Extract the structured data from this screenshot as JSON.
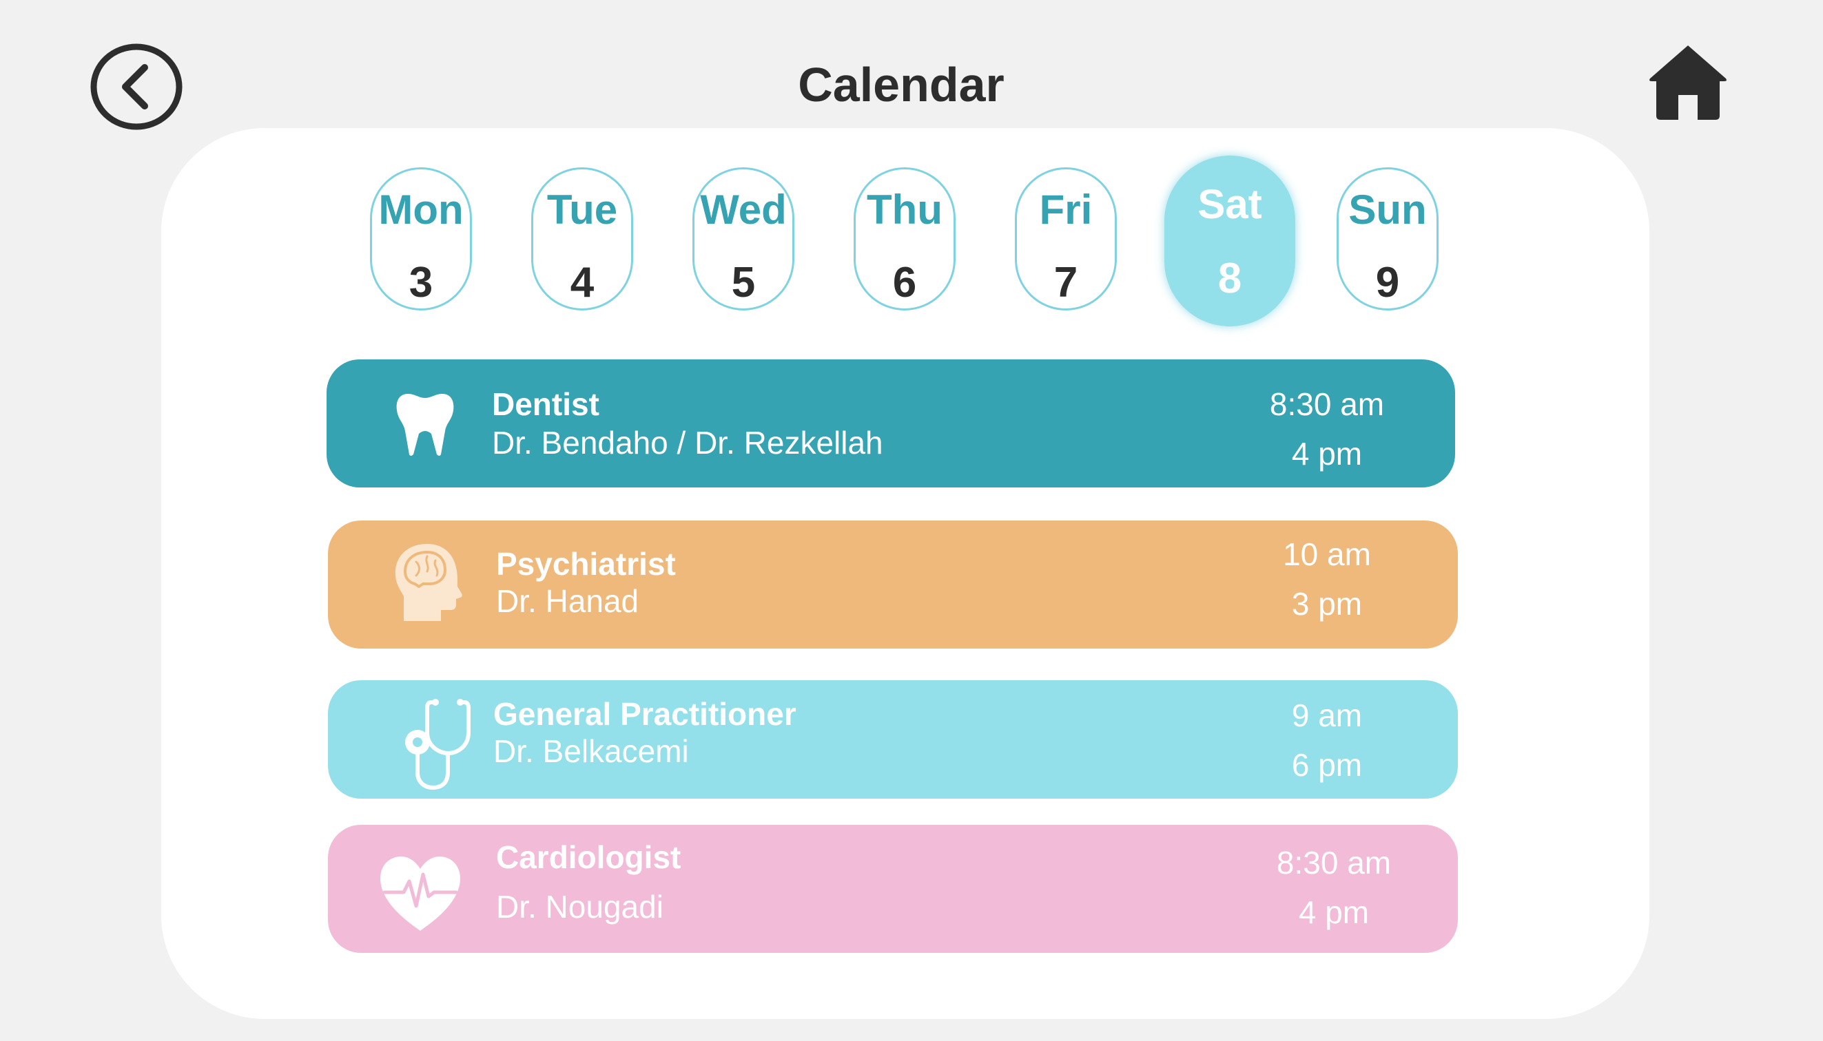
{
  "header": {
    "title": "Calendar"
  },
  "icons": {
    "back": "chevron-left-circle-icon",
    "home": "home-icon"
  },
  "colors": {
    "background": "#f0f1f0",
    "panel": "#ffffff",
    "day_accent": "#36a3b3",
    "day_border": "#7fd3e0",
    "day_selected": "#93e0ea"
  },
  "week": {
    "selected_index": 5,
    "days": [
      {
        "name": "Mon",
        "date": "3"
      },
      {
        "name": "Tue",
        "date": "4"
      },
      {
        "name": "Wed",
        "date": "5"
      },
      {
        "name": "Thu",
        "date": "6"
      },
      {
        "name": "Fri",
        "date": "7"
      },
      {
        "name": "Sat",
        "date": "8"
      },
      {
        "name": "Sun",
        "date": "9"
      }
    ]
  },
  "appointments": [
    {
      "specialty": "Dentist",
      "doctor": "Dr. Bendaho / Dr. Rezkellah",
      "start": "8:30 am",
      "end": "4 pm",
      "color": "#36a3b3",
      "icon": "tooth-icon"
    },
    {
      "specialty": "Psychiatrist",
      "doctor": "Dr. Hanad",
      "start": "10 am",
      "end": "3 pm",
      "color": "#f0b97c",
      "icon": "brain-head-icon"
    },
    {
      "specialty": "General Practitioner",
      "doctor": "Dr. Belkacemi",
      "start": "9 am",
      "end": "6 pm",
      "color": "#93e0ea",
      "icon": "stethoscope-icon"
    },
    {
      "specialty": "Cardiologist",
      "doctor": "Dr. Nougadi",
      "start": "8:30 am",
      "end": "4 pm",
      "color": "#f2bbd8",
      "icon": "heart-pulse-icon"
    }
  ]
}
